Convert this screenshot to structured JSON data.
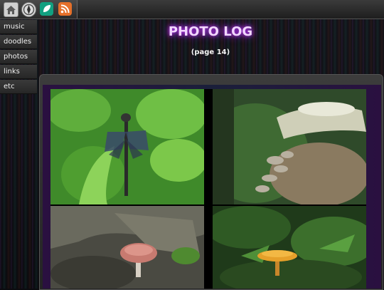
{
  "header": {
    "icons": [
      "home-icon",
      "compass-icon",
      "leaf-icon",
      "rss-icon"
    ]
  },
  "sidebar": {
    "items": [
      {
        "label": "music"
      },
      {
        "label": "doodles"
      },
      {
        "label": "photos"
      },
      {
        "label": "links"
      },
      {
        "label": "etc"
      }
    ]
  },
  "main": {
    "title": "PHOTO LOG",
    "page_label": "(page 14)"
  },
  "colors": {
    "title_glow": "#c23cff",
    "leaf_icon": "#12a080",
    "rss_icon": "#e5702a"
  }
}
